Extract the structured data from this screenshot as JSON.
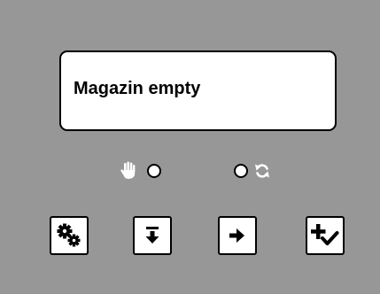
{
  "display": {
    "message": "Magazin empty"
  },
  "indicators": [
    {
      "icon": "hand-icon",
      "state": "off"
    },
    {
      "icon": "refresh-icon",
      "state": "off"
    }
  ],
  "buttons": [
    {
      "icon": "gears-icon"
    },
    {
      "icon": "arrow-down-to-line-icon"
    },
    {
      "icon": "arrow-right-icon"
    },
    {
      "icon": "plus-check-icon"
    }
  ],
  "colors": {
    "panel": "#979797",
    "display_bg": "#ffffff",
    "outline": "#000000",
    "icon_inactive": "#ffffff"
  }
}
